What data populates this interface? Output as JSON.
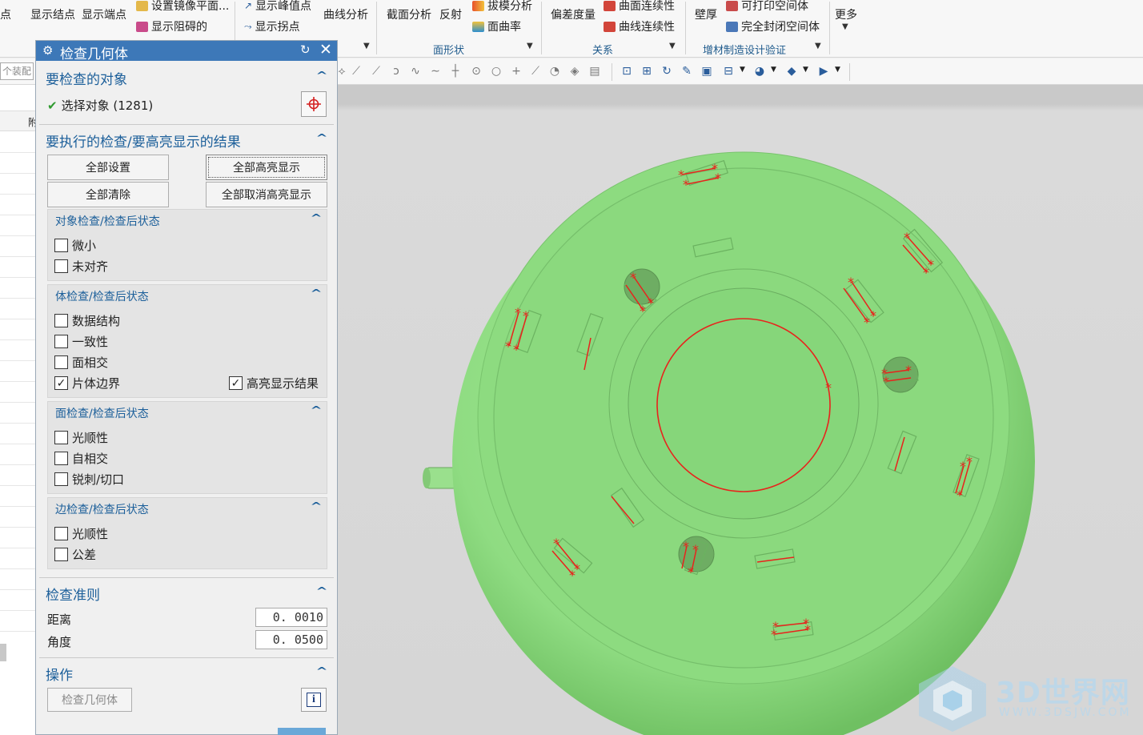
{
  "ribbon": {
    "buttons": [
      {
        "label": "极点",
        "icon": "pole-icon",
        "color": ""
      },
      {
        "label": "显示结点",
        "icon": "",
        "color": ""
      },
      {
        "label": "显示端点",
        "icon": "",
        "color": ""
      },
      {
        "label": "设置镜像平面...",
        "icon": "mirror-plane-icon",
        "color": "#d9a21f"
      },
      {
        "label": "显示阻碍的",
        "icon": "blocked-icon",
        "color": "#c02a6a"
      },
      {
        "label": "显示峰值点",
        "icon": "peak-point-icon",
        "color": "#2a5d9b"
      },
      {
        "label": "显示拐点",
        "icon": "inflection-point-icon",
        "color": "#2a5d9b"
      },
      {
        "label": "曲线分析",
        "icon": "",
        "color": ""
      },
      {
        "label": "截面分析",
        "icon": "",
        "color": ""
      },
      {
        "label": "反射",
        "icon": "",
        "color": ""
      },
      {
        "label": "拔模分析",
        "icon": "draft-analysis-icon",
        "color": "#d8472b"
      },
      {
        "label": "面曲率",
        "icon": "face-curvature-icon",
        "color": "#2c8fd0"
      },
      {
        "label": "偏差度量",
        "icon": "",
        "color": ""
      },
      {
        "label": "曲面连续性",
        "icon": "surface-continuity-icon",
        "color": "#c8342a"
      },
      {
        "label": "曲线连续性",
        "icon": "curve-continuity-icon",
        "color": "#c8342a"
      },
      {
        "label": "壁厚",
        "icon": "",
        "color": ""
      },
      {
        "label": "可打印空间体",
        "icon": "printable-volume-icon",
        "color": "#c02a2a"
      },
      {
        "label": "完全封闭空间体",
        "icon": "enclosed-volume-icon",
        "color": "#2a5d9b"
      },
      {
        "label": "更多",
        "icon": "",
        "color": ""
      }
    ],
    "groups": [
      "面形状",
      "关系",
      "增材制造设计验证"
    ]
  },
  "toolbar": {
    "filter_value": "个装配"
  },
  "navigator": {
    "header": "附"
  },
  "dialog": {
    "title": "检查几何体",
    "sec_objects": {
      "title": "要检查的对象",
      "select_label": "选择对象 (1281)"
    },
    "sec_checks": {
      "title": "要执行的检查/要高亮显示的结果",
      "btn_set_all": "全部设置",
      "btn_highlight_all": "全部高亮显示",
      "btn_clear_all": "全部清除",
      "btn_unhighlight_all": "全部取消高亮显示",
      "object_checks": {
        "title": "对象检查/检查后状态",
        "items": [
          {
            "label": "微小",
            "checked": false
          },
          {
            "label": "未对齐",
            "checked": false
          }
        ]
      },
      "body_checks": {
        "title": "体检查/检查后状态",
        "items": [
          {
            "label": "数据结构",
            "checked": false
          },
          {
            "label": "一致性",
            "checked": false
          },
          {
            "label": "面相交",
            "checked": false
          },
          {
            "label": "片体边界",
            "checked": true
          }
        ],
        "highlight_label": "高亮显示结果",
        "highlight_checked": true
      },
      "face_checks": {
        "title": "面检查/检查后状态",
        "items": [
          {
            "label": "光顺性",
            "checked": false
          },
          {
            "label": "自相交",
            "checked": false
          },
          {
            "label": "锐刺/切口",
            "checked": false
          }
        ]
      },
      "edge_checks": {
        "title": "边检查/检查后状态",
        "items": [
          {
            "label": "光顺性",
            "checked": false
          },
          {
            "label": "公差",
            "checked": false
          }
        ]
      }
    },
    "sec_criteria": {
      "title": "检查准则",
      "distance_label": "距离",
      "distance_value": "0. 0010",
      "angle_label": "角度",
      "angle_value": "0. 0500"
    },
    "sec_ops": {
      "title": "操作",
      "check_button": "检查几何体"
    }
  },
  "viewport": {
    "model_color": "#8fdc82",
    "highlight_color": "#e8231c",
    "background": "#d6d6d6"
  },
  "watermark": {
    "main": "3D世界网",
    "url": "WWW.3DSJW.COM"
  }
}
